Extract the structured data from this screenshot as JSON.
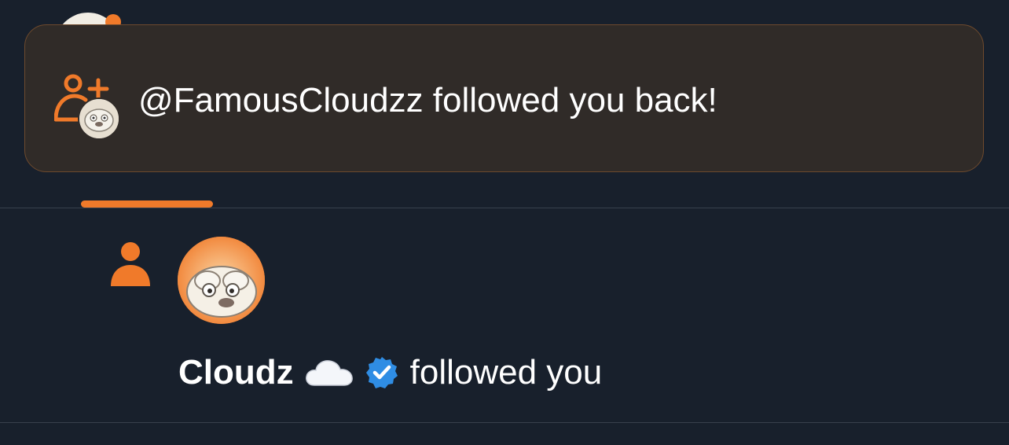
{
  "toast": {
    "message": "@FamousCloudzz followed you back!",
    "icon": "person-add-icon"
  },
  "notification": {
    "type_icon": "person-icon",
    "user_name": "Cloudz",
    "name_emoji": "cloud-emoji",
    "badge": "verified-badge-icon",
    "action_text": "followed you"
  },
  "colors": {
    "background": "#18202c",
    "accent": "#f07a2a",
    "toast_bg": "#302b28",
    "verified": "#1d9bf0"
  }
}
